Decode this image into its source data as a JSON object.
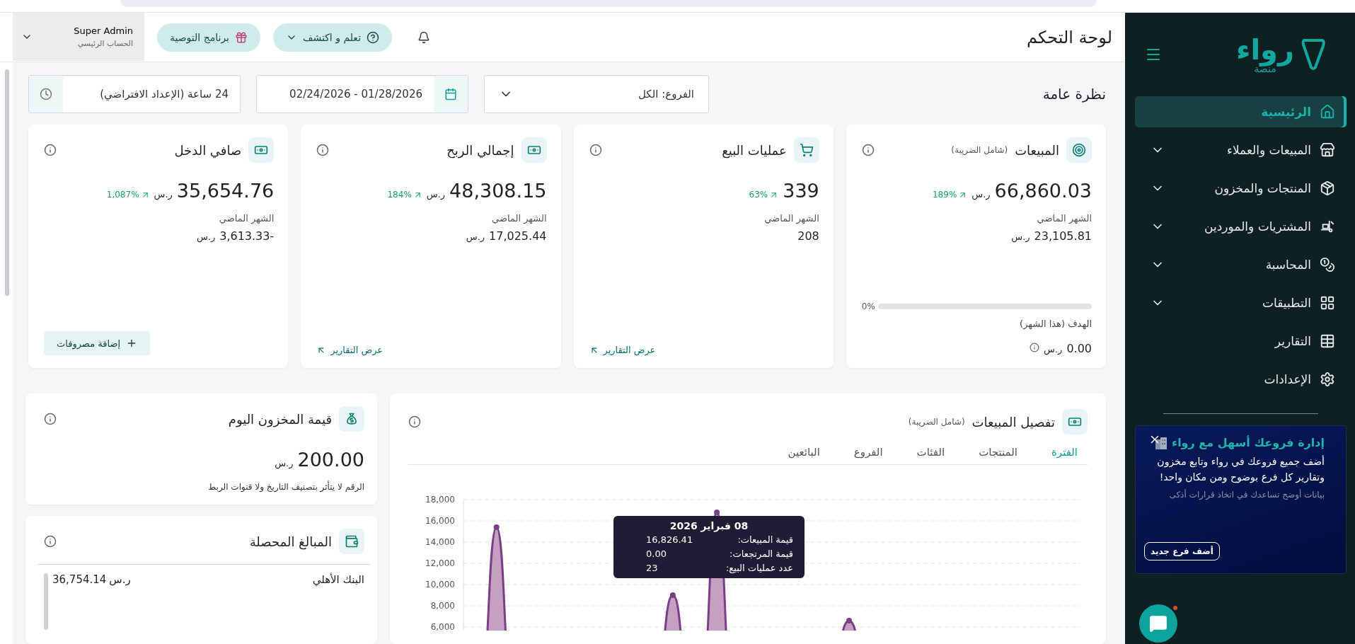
{
  "sidebar": {
    "logo": {
      "name": "رواء",
      "tagline": "منصة"
    },
    "items": [
      {
        "label": "الرئيسية",
        "selected": true,
        "has_submenu": false
      },
      {
        "label": "المبيعات والعملاء",
        "selected": false,
        "has_submenu": true
      },
      {
        "label": "المنتجات والمخزون",
        "selected": false,
        "has_submenu": true
      },
      {
        "label": "المشتريات والموردين",
        "selected": false,
        "has_submenu": true
      },
      {
        "label": "المحاسبة",
        "selected": false,
        "has_submenu": true
      },
      {
        "label": "التطبيقات",
        "selected": false,
        "has_submenu": true
      },
      {
        "label": "التقارير",
        "selected": false,
        "has_submenu": false
      },
      {
        "label": "الإعدادات",
        "selected": false,
        "has_submenu": false
      }
    ],
    "promo": {
      "title": "إدارة فروعك أسهل مع رواء",
      "body": "أضف جميع فروعك في رواء وتابع مخزون وتقارير كل فرع بوضوح ومن مكان واحد!",
      "note": "بيانات أوضح تساعدك في اتخاذ قرارات أذكى",
      "button": "أضف فرع جديد"
    }
  },
  "header": {
    "title": "لوحة التحكم",
    "learn_button": "تعلم و اكتشف",
    "referral_button": "برنامج التوصية",
    "user": {
      "name": "Super Admin",
      "role": "الحساب الرئيسي"
    }
  },
  "overview": {
    "title": "نظرة عامة",
    "branch_filter": "الفروع: الكل",
    "date_range": "01/28/2026 - 02/24/2026",
    "time_filter": "24 ساعة (الإعداد الافتراضي)"
  },
  "cards": [
    {
      "title": "المبيعات",
      "subtitle": "(شامل الضريبة)",
      "value": "66,860.03",
      "currency": "ر.س",
      "change": "189%",
      "last_label": "الشهر الماضي",
      "last_value": "23,105.81",
      "last_currency": "ر.س",
      "footer": {
        "kind": "target",
        "level": 0,
        "percent": "0%",
        "label": "الهدف (هذا الشهر)",
        "value": "0.00",
        "currency": "ر.س"
      }
    },
    {
      "title": "عمليات البيع",
      "value": "339",
      "change": "63%",
      "last_label": "الشهر الماضي",
      "last_value": "208",
      "footer": {
        "kind": "link",
        "label": "عرض التقارير"
      }
    },
    {
      "title": "إجمالي الربح",
      "value": "48,308.15",
      "currency": "ر.س",
      "change": "184%",
      "last_label": "الشهر الماضي",
      "last_value": "17,025.44",
      "last_currency": "ر.س",
      "footer": {
        "kind": "link",
        "label": "عرض التقارير"
      }
    },
    {
      "title": "صافي الدخل",
      "value": "35,654.76",
      "currency": "ر.س",
      "change": "1,087%",
      "last_label": "الشهر الماضي",
      "last_value": "-3,613.33",
      "last_currency": "ر.س",
      "footer": {
        "kind": "button",
        "label": "إضافة مصروفات"
      }
    }
  ],
  "inventory": {
    "title": "قيمة المخزون اليوم",
    "value": "200.00",
    "currency": "ر.س",
    "note": "الرقم لا يتأثر بتصنيف التاريخ ولا قنوات الربط"
  },
  "collected": {
    "title": "المبالغ المحصلة",
    "rows": [
      {
        "name": "البنك الأهلي",
        "amount": "36,754.14",
        "currency": "ر.س"
      }
    ]
  },
  "sales_breakdown": {
    "title": "تفصيل المبيعات",
    "subtitle": "(شامل الضريبة)",
    "tabs": [
      {
        "label": "الفترة",
        "selected": true
      },
      {
        "label": "المنتجات",
        "selected": false
      },
      {
        "label": "الفئات",
        "selected": false
      },
      {
        "label": "الفروع",
        "selected": false
      },
      {
        "label": "البائعين",
        "selected": false
      }
    ],
    "chart_data": {
      "type": "area",
      "grid": true,
      "ylim": [
        6000,
        18000
      ],
      "yticks": [
        {
          "value": 6000,
          "label": "6,000"
        },
        {
          "value": 8000,
          "label": "8,000"
        },
        {
          "value": 10000,
          "label": "10,000"
        },
        {
          "value": 12000,
          "label": "12,000"
        },
        {
          "value": 14000,
          "label": "14,000"
        },
        {
          "value": 16000,
          "label": "16,000"
        },
        {
          "value": 18000,
          "label": "18,000"
        }
      ],
      "values": [
        null,
        15400,
        null,
        null,
        null,
        null,
        null,
        null,
        null,
        9000,
        null,
        16800,
        null,
        null,
        null,
        null,
        null,
        6600,
        null,
        null,
        null,
        null,
        null,
        null,
        null,
        null,
        null,
        null
      ]
    },
    "tooltip": {
      "date": "08 فبراير 2026",
      "rows": [
        {
          "label": "قيمة المبيعات:",
          "value": "16,826.41"
        },
        {
          "label": "قيمة المرتجعات:",
          "value": "0.00"
        },
        {
          "label": "عدد عمليات البيع:",
          "value": "23"
        }
      ]
    }
  }
}
